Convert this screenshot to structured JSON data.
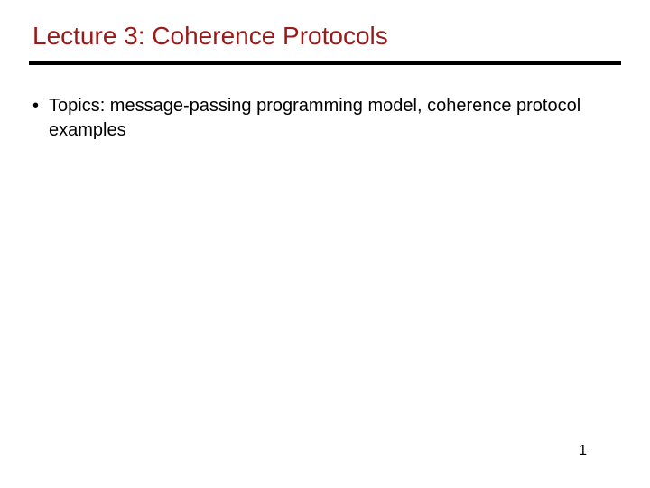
{
  "slide": {
    "title": "Lecture 3: Coherence Protocols",
    "bullets": [
      {
        "marker": "•",
        "text": "Topics: message-passing programming model, coherence protocol examples"
      }
    ],
    "page_number": "1"
  }
}
